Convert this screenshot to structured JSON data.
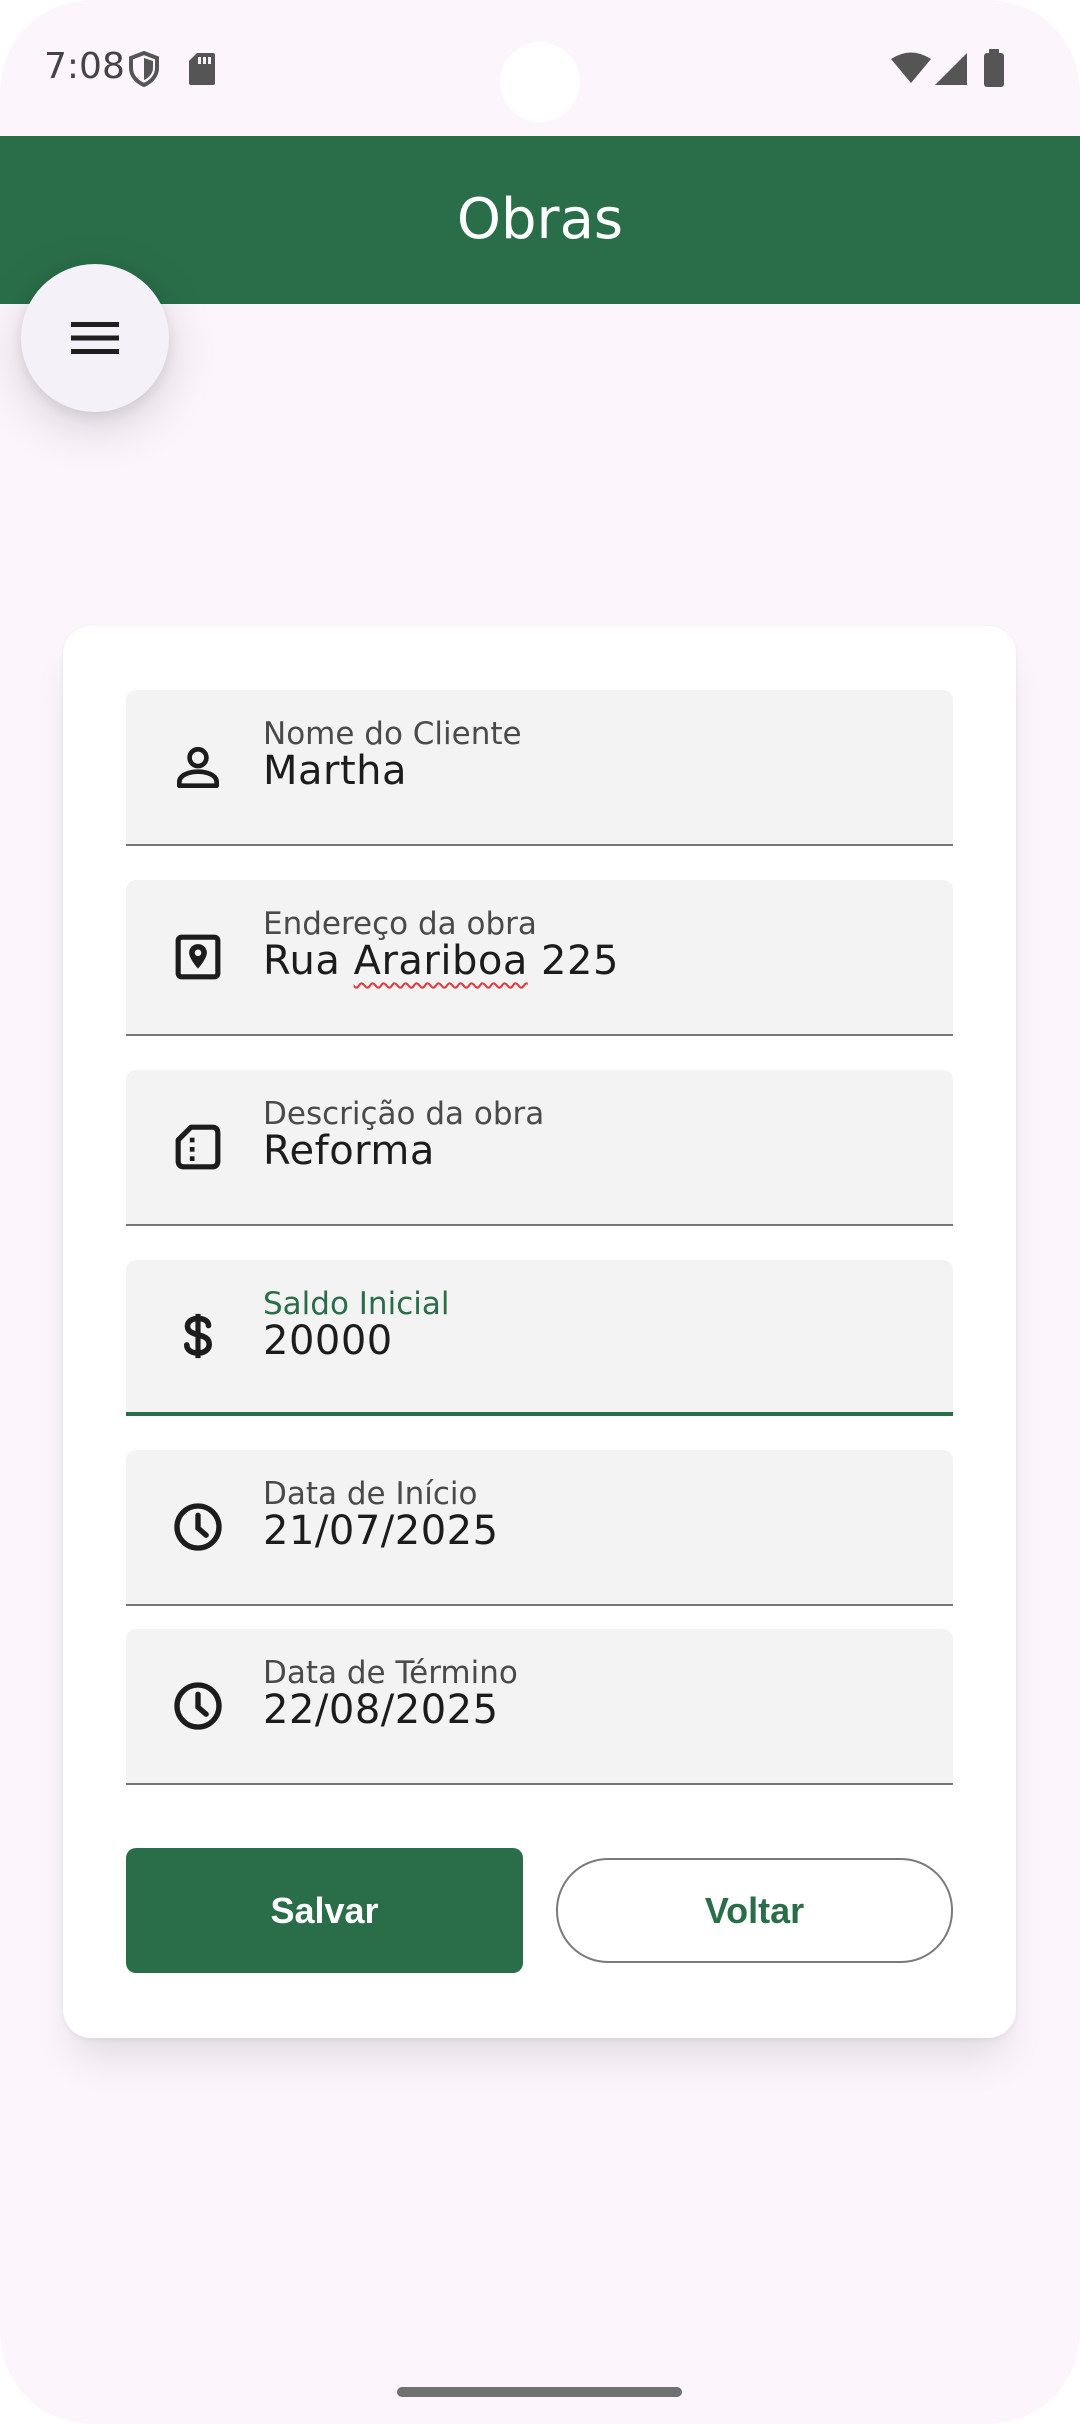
{
  "status_bar": {
    "time": "7:08",
    "icons": [
      "shield-icon",
      "sd-card-icon",
      "wifi-icon",
      "cellular-signal-icon",
      "battery-icon"
    ]
  },
  "app_bar": {
    "title": "Obras",
    "menu_icon": "hamburger-menu-icon",
    "color": "#2a6e49"
  },
  "form": {
    "fields": [
      {
        "label": "Nome do Cliente",
        "value": "Martha",
        "icon": "person-icon"
      },
      {
        "label": "Endereço da obra",
        "value_before": "Rua ",
        "value_misspelled": "Arariboa",
        "value_after": " 225",
        "icon": "location-pin-icon"
      },
      {
        "label": "Descrição da obra",
        "value": "Reforma",
        "icon": "document-icon"
      },
      {
        "label": "Saldo Inicial",
        "value": "20000",
        "icon": "dollar-icon",
        "focused": true
      },
      {
        "label": "Data de Início",
        "value": "21/07/2025",
        "icon": "clock-icon"
      },
      {
        "label": "Data de Término",
        "value": "22/08/2025",
        "icon": "clock-icon"
      }
    ],
    "save_label": "Salvar",
    "back_label": "Voltar"
  },
  "colors": {
    "primary": "#2a6e49",
    "background": "#fcf5fc",
    "field_background": "#f3f3f3",
    "spellcheck_underline": "#e0383e"
  }
}
